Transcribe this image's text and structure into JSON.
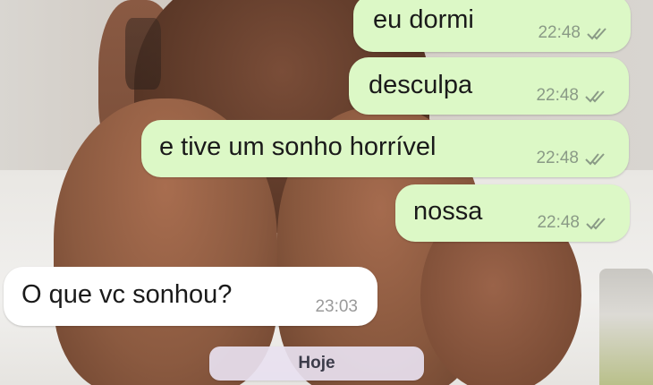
{
  "chat": {
    "messages": [
      {
        "direction": "outgoing",
        "text": "eu dormi",
        "time": "22:48",
        "status": "read"
      },
      {
        "direction": "outgoing",
        "text": "desculpa",
        "time": "22:48",
        "status": "read"
      },
      {
        "direction": "outgoing",
        "text": "e tive um sonho horrível",
        "time": "22:48",
        "status": "read"
      },
      {
        "direction": "outgoing",
        "text": "nossa",
        "time": "22:48",
        "status": "read"
      },
      {
        "direction": "incoming",
        "text": "O que vc sonhou?",
        "time": "23:03"
      }
    ],
    "date_separator": "Hoje"
  },
  "colors": {
    "outgoing_bubble": "#dcf8c6",
    "incoming_bubble": "#ffffff",
    "read_tick": "#8a9a86",
    "date_chip": "#e8e1f0"
  },
  "icons": {
    "read_receipt": "double-check-icon"
  }
}
